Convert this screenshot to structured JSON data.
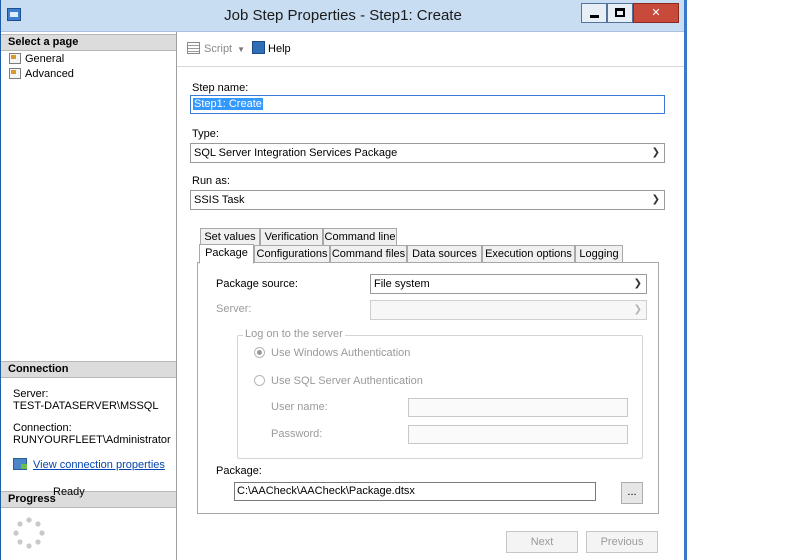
{
  "window": {
    "title": "Job Step Properties - Step1: Create"
  },
  "sidebar": {
    "select_page_header": "Select a page",
    "pages": [
      {
        "label": "General"
      },
      {
        "label": "Advanced"
      }
    ],
    "connection_header": "Connection",
    "server_label": "Server:",
    "server_value": "TEST-DATASERVER\\MSSQL",
    "connection_label": "Connection:",
    "connection_value": "RUNYOURFLEET\\Administrator",
    "view_connection_link": "View connection properties",
    "progress_header": "Progress",
    "progress_status": "Ready"
  },
  "toolbar": {
    "script_label": "Script",
    "help_label": "Help"
  },
  "form": {
    "step_name_label": "Step name:",
    "step_name_value": "Step1: Create",
    "type_label": "Type:",
    "type_value": "SQL Server Integration Services Package",
    "run_as_label": "Run as:",
    "run_as_value": "SSIS Task"
  },
  "tabs": {
    "row1": [
      "Set values",
      "Verification",
      "Command line"
    ],
    "row2": [
      "Package",
      "Configurations",
      "Command files",
      "Data sources",
      "Execution options",
      "Logging"
    ],
    "active": "Package"
  },
  "package_tab": {
    "package_source_label": "Package source:",
    "package_source_value": "File system",
    "server_label": "Server:",
    "server_value": "",
    "logon_group_title": "Log on to the server",
    "windows_auth_label": "Use Windows Authentication",
    "sql_auth_label": "Use SQL Server Authentication",
    "auth_selected": "windows",
    "user_name_label": "User name:",
    "password_label": "Password:",
    "package_label": "Package:",
    "package_value": "C:\\AACheck\\AACheck\\Package.dtsx",
    "browse_label": "..."
  },
  "buttons": {
    "next": "Next",
    "previous": "Previous"
  }
}
